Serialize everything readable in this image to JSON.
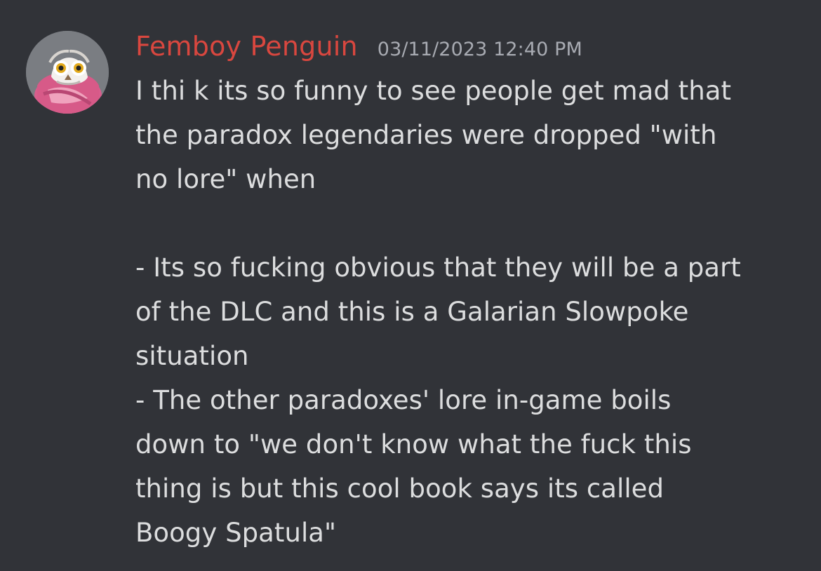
{
  "message": {
    "username": "Femboy Penguin",
    "timestamp": "03/11/2023 12:40 PM",
    "avatar_icon": "owl-plush-avatar-icon",
    "lines": [
      "I thi k its so funny to see people get mad that",
      "the paradox legendaries were dropped \"with",
      "no lore\" when",
      "",
      "- Its so fucking obvious that they will be a part",
      "of the DLC and this is a Galarian Slowpoke",
      "situation",
      "- The other paradoxes' lore in-game boils",
      "down to \"we don't know what the fuck this",
      "thing is but this cool book says its called",
      "Boogy Spatula\""
    ]
  },
  "colors": {
    "background": "#313338",
    "username": "#d9473f",
    "timestamp": "#a8abb2",
    "text": "#dcddde"
  }
}
